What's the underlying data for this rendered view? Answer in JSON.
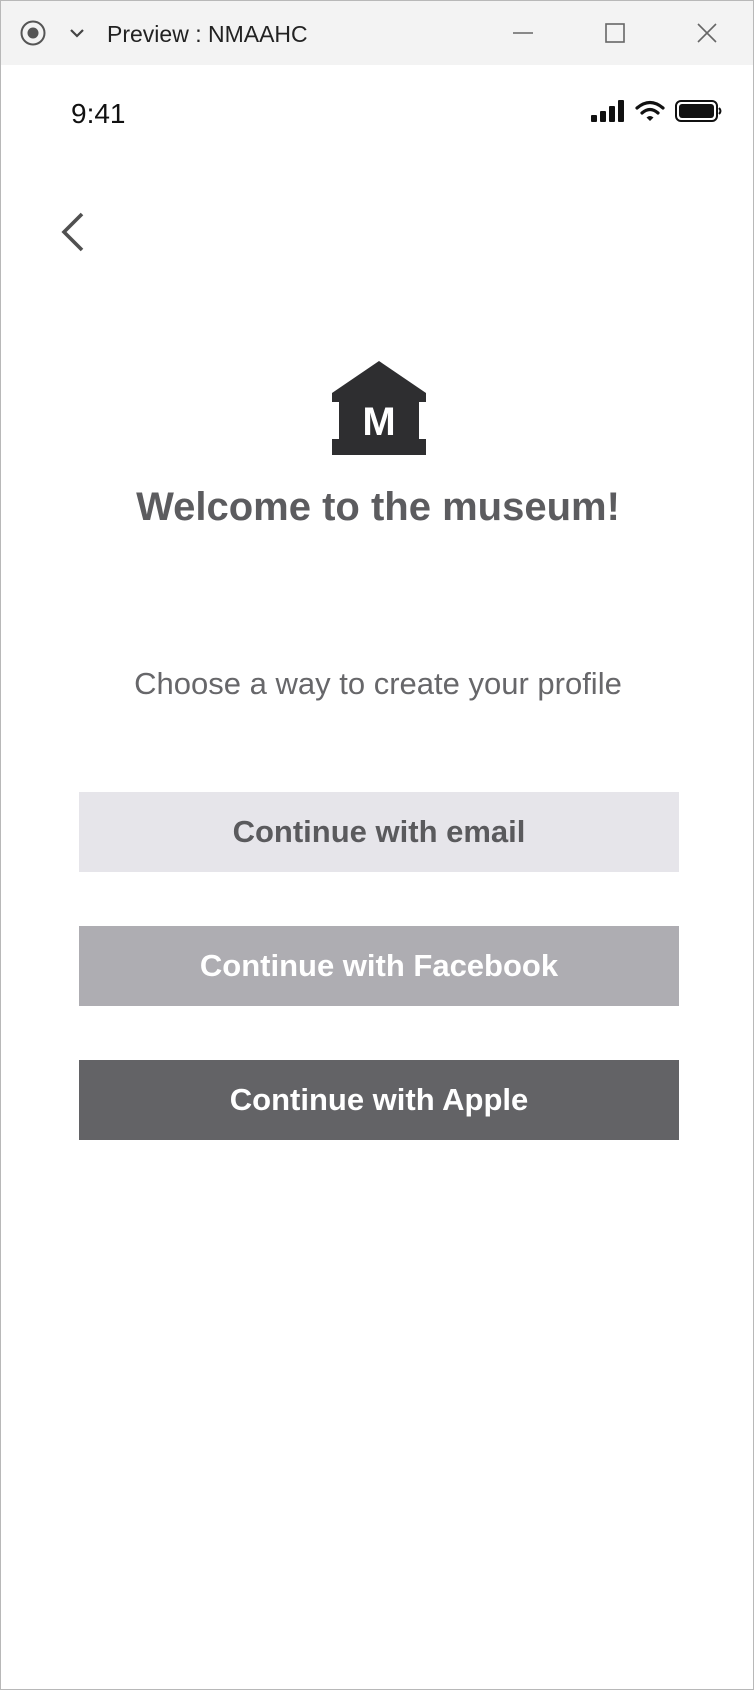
{
  "window": {
    "title": "Preview : NMAAHC",
    "icons": {
      "record": "record-icon",
      "menu": "chevron-down-icon",
      "minimize": "minimize-icon",
      "maximize": "maximize-icon",
      "close": "close-icon"
    }
  },
  "status_bar": {
    "time": "9:41",
    "icons": [
      "signal-icon",
      "wifi-icon",
      "battery-icon"
    ]
  },
  "nav": {
    "back_icon": "chevron-left-icon"
  },
  "header": {
    "logo_icon": "museum-icon",
    "logo_letter": "M",
    "title": "Welcome to the museum!"
  },
  "main": {
    "prompt": "Choose a way to create your profile",
    "buttons": [
      {
        "label": "Continue with email",
        "background": "#e6e5ea",
        "color": "#5a5a5d"
      },
      {
        "label": "Continue with Facebook",
        "background": "#aeadb2",
        "color": "#ffffff"
      },
      {
        "label": "Continue with Apple",
        "background": "#636366",
        "color": "#ffffff"
      }
    ]
  }
}
